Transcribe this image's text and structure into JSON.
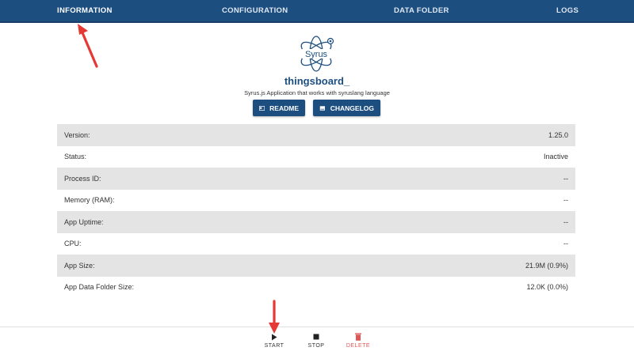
{
  "nav": {
    "tabs": [
      {
        "label": "INFORMATION",
        "active": true
      },
      {
        "label": "CONFIGURATION",
        "active": false
      },
      {
        "label": "DATA FOLDER",
        "active": false
      },
      {
        "label": "LOGS",
        "active": false
      }
    ]
  },
  "app": {
    "logo_text": "Syrus",
    "name": "thingsboard_",
    "description": "Syrus.js Application that works with syruslang language"
  },
  "buttons": {
    "readme": "README",
    "changelog": "CHANGELOG"
  },
  "info": {
    "rows": [
      {
        "label": "Version:",
        "value": "1.25.0"
      },
      {
        "label": "Status:",
        "value": "Inactive"
      },
      {
        "label": "Process ID:",
        "value": "--"
      },
      {
        "label": "Memory (RAM):",
        "value": "--"
      },
      {
        "label": "App Uptime:",
        "value": "--"
      },
      {
        "label": "CPU:",
        "value": "--"
      },
      {
        "label": "App Size:",
        "value": "21.9M (0.9%)"
      },
      {
        "label": "App Data Folder Size:",
        "value": "12.0K (0.0%)"
      }
    ]
  },
  "actions": {
    "start": "START",
    "stop": "STOP",
    "delete": "DELETE"
  },
  "colors": {
    "primary": "#1c4e80",
    "row_alt": "#e4e4e4",
    "delete": "#e05555",
    "annotation_arrow": "#e53935"
  }
}
